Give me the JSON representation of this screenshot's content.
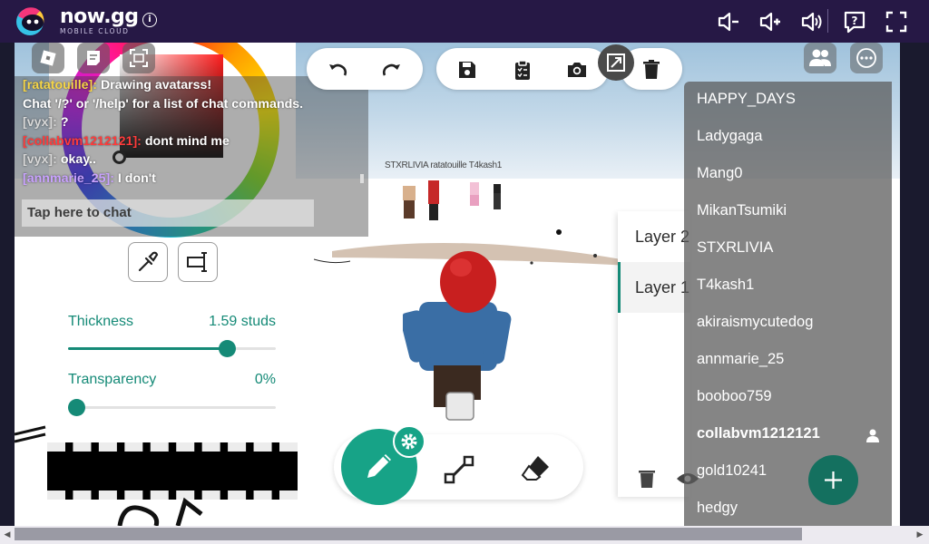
{
  "host": {
    "brand_name": "now.gg",
    "brand_subtitle": "MOBILE CLOUD",
    "info_icon": "info-icon",
    "controls": [
      "volume-down-icon",
      "volume-up-icon",
      "volume-icon",
      "help-icon",
      "fullscreen-icon"
    ]
  },
  "chat": {
    "lines": [
      {
        "name": "[ratatouille]:",
        "name_color": "#f5d547",
        "text": "Drawing avatarss!"
      },
      {
        "name": "",
        "name_color": "#ffffff",
        "text": "Chat '/?' or '/help' for a list of chat commands."
      },
      {
        "name": "[vyx]:",
        "name_color": "#d7d7d7",
        "text": "?"
      },
      {
        "name": "[collabvm1212121]:",
        "name_color": "#ff3b3b",
        "text": "dont mind me"
      },
      {
        "name": "[vyx]:",
        "name_color": "#d7d7d7",
        "text": "okay.."
      },
      {
        "name": "[annmarie_25]:",
        "name_color": "#c9a2ff",
        "text": "I don't"
      }
    ],
    "input_placeholder": "Tap here to chat"
  },
  "draw_panel": {
    "thickness_label": "Thickness",
    "thickness_value": "1.59 studs",
    "thickness_fraction": 0.79,
    "transparency_label": "Transparency",
    "transparency_value": "0%",
    "transparency_fraction": 0.0
  },
  "world": {
    "nametag": "STXRLIVIA ratatouille T4kash1"
  },
  "layers": {
    "items": [
      "Layer 2",
      "Layer 1"
    ],
    "active": "Layer 1"
  },
  "players": {
    "items": [
      "HAPPY_DAYS",
      "Ladygaga",
      "Mang0",
      "MikanTsumiki",
      "STXRLIVIA",
      "T4kash1",
      "akiraismycutedog",
      "annmarie_25",
      "booboo759",
      "collabvm1212121",
      "gold10241",
      "hedgy"
    ],
    "self": "collabvm1212121"
  },
  "colors": {
    "accent": "#158a77",
    "host_bar": "#261845"
  }
}
